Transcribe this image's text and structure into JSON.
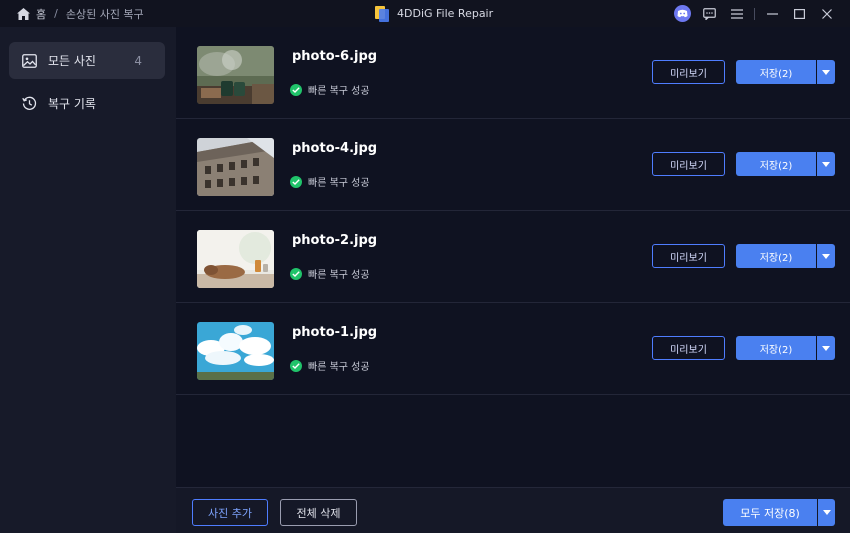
{
  "breadcrumb": {
    "home": "홈",
    "separator": "/",
    "current": "손상된 사진 복구"
  },
  "app": {
    "title": "4DDiG File Repair"
  },
  "window_controls": [
    "discord-icon",
    "chat-icon",
    "menu-icon",
    "minimize-icon",
    "maximize-icon",
    "close-icon"
  ],
  "sidebar": {
    "items": [
      {
        "label": "모든 사진",
        "count": "4",
        "icon": "image-icon",
        "active": true
      },
      {
        "label": "복구 기록",
        "count": "",
        "icon": "history-icon",
        "active": false
      }
    ]
  },
  "photos": [
    {
      "name": "photo-6.jpg",
      "status": "빠른 복구 성공",
      "preview": "미리보기",
      "save": "저장(2)",
      "thumb": "campfire-cups"
    },
    {
      "name": "photo-4.jpg",
      "status": "빠른 복구 성공",
      "preview": "미리보기",
      "save": "저장(2)",
      "thumb": "building"
    },
    {
      "name": "photo-2.jpg",
      "status": "빠른 복구 성공",
      "preview": "미리보기",
      "save": "저장(2)",
      "thumb": "sleeping-dog"
    },
    {
      "name": "photo-1.jpg",
      "status": "빠른 복구 성공",
      "preview": "미리보기",
      "save": "저장(2)",
      "thumb": "sky-clouds"
    }
  ],
  "bottom": {
    "add": "사진 추가",
    "delete_all": "전체 삭제",
    "save_all": "모두 저장(8)"
  },
  "colors": {
    "accent": "#4a80f0",
    "success": "#20c36a",
    "background": "#0f1221",
    "sidebar": "#171a29"
  }
}
